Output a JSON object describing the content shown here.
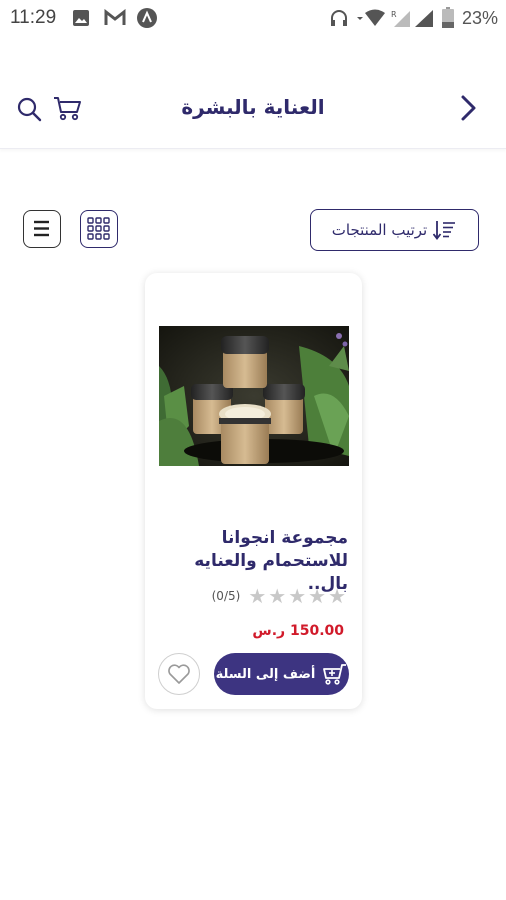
{
  "status_bar": {
    "time": "11:29",
    "battery": "23%"
  },
  "header": {
    "title": "العناية بالبشرة"
  },
  "toolbar": {
    "sort_label": "ترتيب المنتجات"
  },
  "products": [
    {
      "title_line1": "مجموعة انجوانا",
      "title_line2": "للاستحمام والعنايه بال..",
      "rating_count": "(0/5)",
      "price": "150.00 ر.س",
      "add_to_cart_label": "أضف إلى السلة"
    }
  ],
  "colors": {
    "primary": "#3d3481",
    "price": "#d11a2a",
    "title": "#2f2a6b"
  }
}
